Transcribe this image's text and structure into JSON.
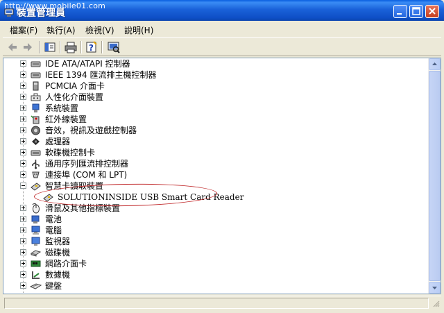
{
  "window": {
    "title": "裝置管理員",
    "watermark": "http://www.mobile01.com"
  },
  "menu": [
    {
      "label": "檔案(F)"
    },
    {
      "label": "執行(A)"
    },
    {
      "label": "檢視(V)"
    },
    {
      "label": "說明(H)"
    }
  ],
  "toolbar": [
    "back-arrow-icon",
    "forward-arrow-icon",
    "properties-icon",
    "print-icon",
    "help-icon",
    "scan-hardware-icon"
  ],
  "tree": {
    "items": [
      {
        "label": "IDE ATA/ATAPI 控制器",
        "icon": "ide-controller-icon",
        "expanded": false
      },
      {
        "label": "IEEE 1394 匯流排主機控制器",
        "icon": "ieee1394-controller-icon",
        "expanded": false
      },
      {
        "label": "PCMCIA 介面卡",
        "icon": "pcmcia-adapter-icon",
        "expanded": false
      },
      {
        "label": "人性化介面裝置",
        "icon": "hid-device-icon",
        "expanded": false
      },
      {
        "label": "系統裝置",
        "icon": "system-device-icon",
        "expanded": false
      },
      {
        "label": "紅外線裝置",
        "icon": "infrared-device-icon",
        "expanded": false
      },
      {
        "label": "音效，視訊及遊戲控制器",
        "icon": "sound-video-game-icon",
        "expanded": false
      },
      {
        "label": "處理器",
        "icon": "processor-icon",
        "expanded": false
      },
      {
        "label": "軟碟機控制卡",
        "icon": "floppy-controller-icon",
        "expanded": false
      },
      {
        "label": "通用序列匯流排控制器",
        "icon": "usb-controller-icon",
        "expanded": false
      },
      {
        "label": "連接埠 (COM 和 LPT)",
        "icon": "port-icon",
        "expanded": false
      },
      {
        "label": "智慧卡讀取裝置",
        "icon": "smart-card-reader-icon",
        "expanded": true
      },
      {
        "label": "SOLUTIONINSIDE USB Smart Card Reader",
        "icon": "smart-card-device-icon",
        "child": true
      },
      {
        "label": "滑鼠及其他指標裝置",
        "icon": "mouse-icon",
        "expanded": false
      },
      {
        "label": "電池",
        "icon": "battery-icon",
        "expanded": false
      },
      {
        "label": "電腦",
        "icon": "computer-icon",
        "expanded": false
      },
      {
        "label": "監視器",
        "icon": "monitor-icon",
        "expanded": false
      },
      {
        "label": "磁碟機",
        "icon": "disk-drive-icon",
        "expanded": false
      },
      {
        "label": "網路介面卡",
        "icon": "network-adapter-icon",
        "expanded": false
      },
      {
        "label": "數據機",
        "icon": "modem-icon",
        "expanded": false
      },
      {
        "label": "鍵盤",
        "icon": "keyboard-icon",
        "expanded": false
      }
    ]
  },
  "colors": {
    "titlebar": "#0e4fc6",
    "annotation": "#c0282a",
    "window_bg": "#ece9d8"
  }
}
